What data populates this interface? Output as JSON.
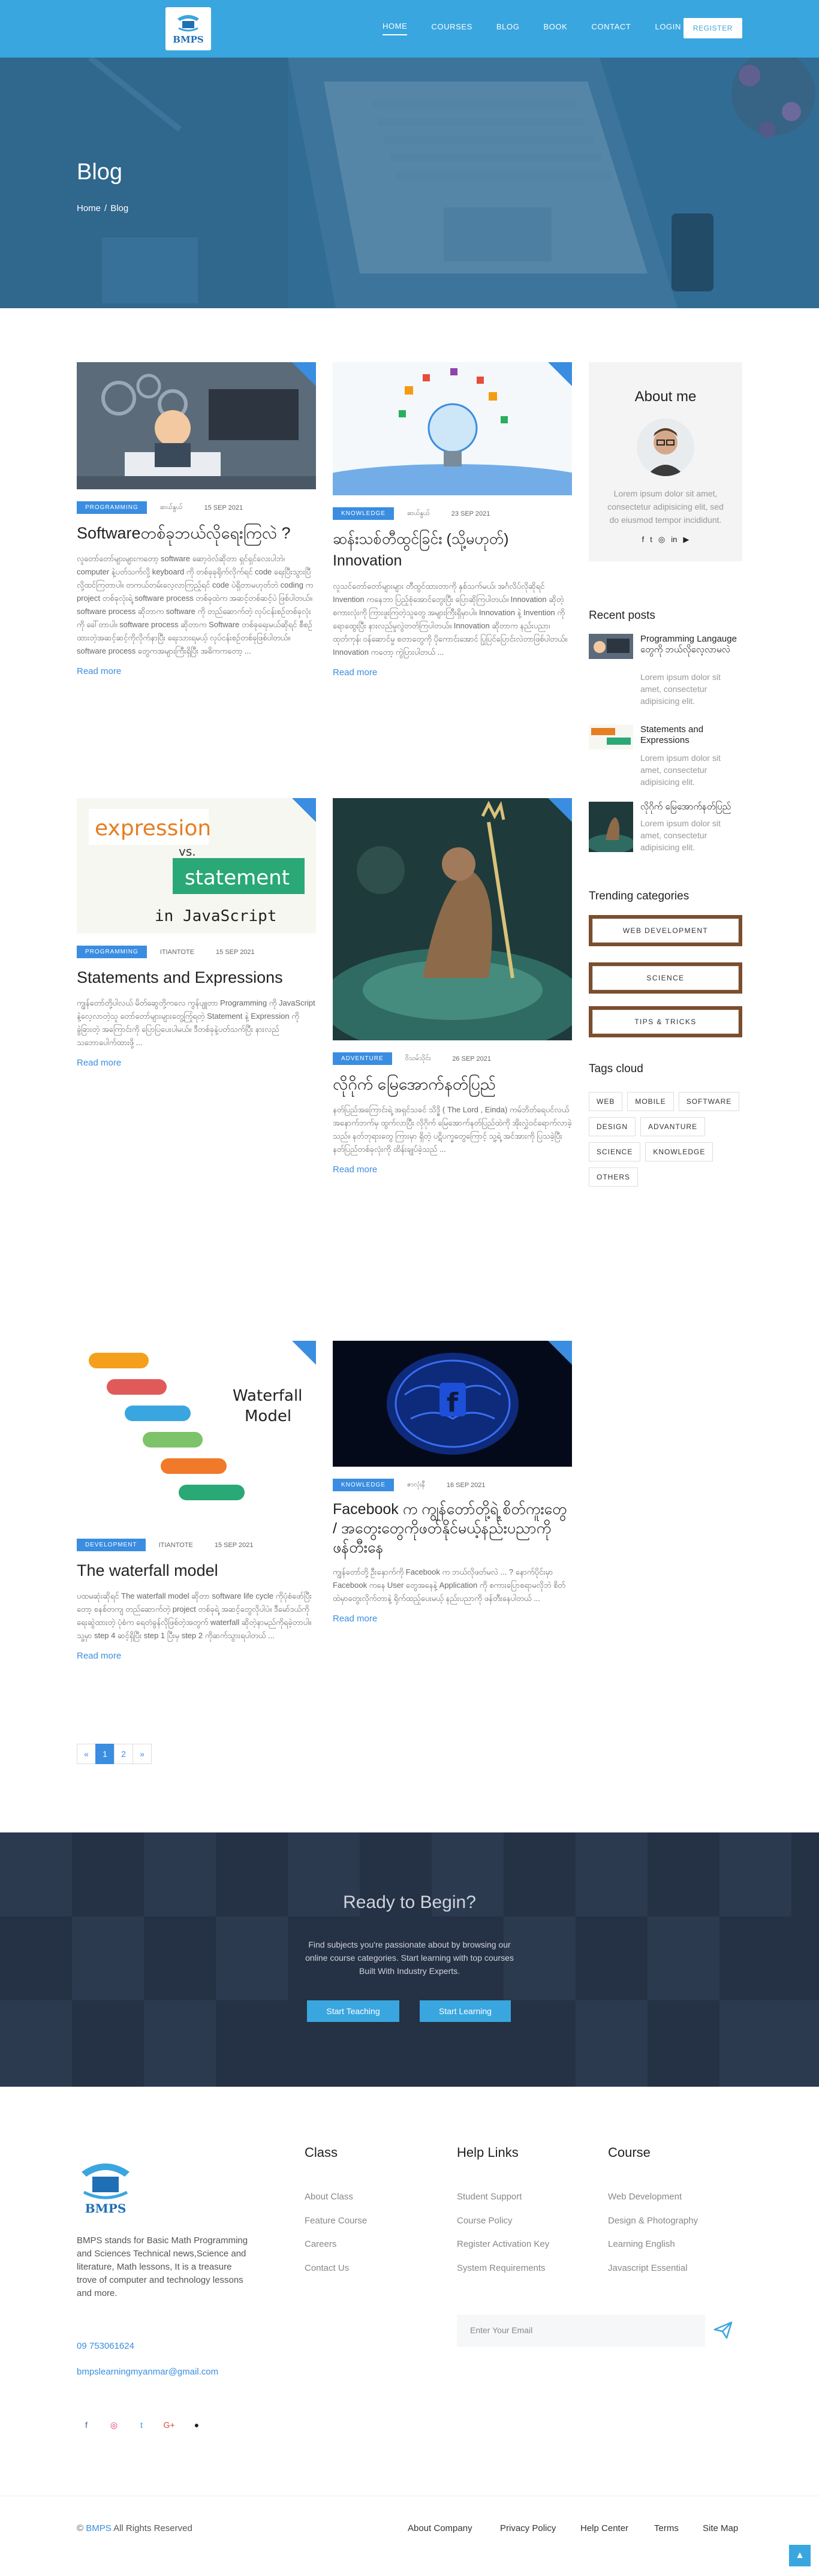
{
  "header": {
    "logo_text": "BMPS",
    "nav": [
      "HOME",
      "COURSES",
      "BLOG",
      "BOOK",
      "CONTACT",
      "LOGIN"
    ],
    "register": "REGISTER"
  },
  "hero": {
    "title": "Blog",
    "breadcrumb": [
      "Home",
      "/",
      "Blog"
    ]
  },
  "posts": [
    {
      "category": "PROGRAMMING",
      "author": "ဆယ်နွယ်",
      "date": "15 SEP 2021",
      "title": "Softwareတစ်ခုဘယ်လိုရေးကြလဲ ?",
      "excerpt": "လူတော်တော်များများကတော့ software ဆော့ဝဲလ်ဆိုတာ ရှင်ရှင်လေးပါဘဲ၊ computer နဲ့ပတ်သက်လို့ keyboard ကို တစ်ခုခုရိုက်လိုက်ရင် code ရေးပြီးသွားပြီလို့ထင်ကြတာပါ။ တကယ်တမ်းလေ့လာကြည့်ရင် code ပဲရှိတာမဟုတ်ဘဲ coding က project တစ်ခုလုံးရဲ့ software process တစ်ခုထဲက အဆင့်တစ်ဆင့်ပဲ ဖြစ်ပါတယ်။ software process ဆိုတာက software ကို တည်ဆောက်တဲ့ လုပ်ငန်းစဉ်တစ်ခုလုံးကို ခေါ်တာပါ။ software process ဆိုတာက Software တစ်ခုရေးမယ်ဆိုရင် စီစဉ်ထားတဲ့အဆင့်ဆင့်ကိုလိုက်နာပြီး ရေးသားရမယ့် လုပ်ငန်းစဉ်တစ်ခုဖြစ်ပါတယ်။ software process တွေကအများကြီးရှိပြီး အဓိကကတော့ ...",
      "more": "Read more"
    },
    {
      "category": "KNOWLEDGE",
      "author": "ဆယ်နွယ်",
      "date": "23 SEP 2021",
      "title": "ဆန်းသစ်တီထွင်ခြင်း (သို့မဟုတ်) Innovation",
      "excerpt": "လူသင်တော်တော်များများ တီထွင်ထားတာကို နှစ်သက်မယ်၊ အင်္ဂလိပ်လိုဆိုရင် Invention ကနေဘာ ပြည့်စုံအောင်တွေးပြီး ပြောဆိုကြပါတယ်။ Innovation ဆိုတဲ့ စကားလုံးကို ကြားဖူးကြတဲ့သူတွေ အများကြီးရှိမှာပါ။ Innovation နဲ့ Invention ကို ရောထွေးပြီး နားလည်မှုလွဲတတ်ကြပါတယ်။ Innovation ဆိုတာက နည်းပညာ၊ ထုတ်ကုန်၊ ဝန်ဆောင်မှု စတာတွေကို ပိုကောင်းအောင် ပြုပြင်ပြောင်းလဲတာဖြစ်ပါတယ်။ Innovation ကတော့ ကွဲပြားပါတယ် ...",
      "more": "Read more"
    },
    {
      "category": "PROGRAMMING",
      "author": "ITIANTOTE",
      "date": "15 SEP 2021",
      "title": "Statements and Expressions",
      "excerpt": "ကျွန်တော်တို့ပါလယ် မိတ်ဆွေတို့ကလေ ကွန်ပျူတာ Programming ကို JavaScript နဲ့လေ့လာတဲ့သူ တော်တော်များများတွေ့ကြုံရတဲ့ Statement နဲ့ Expression ကို ခွဲခြားတဲ့ အကြောင်းကို ပြောပြပေးပါမယ်။ ဒီတစ်ခုနဲ့ပတ်သက်ပြီး နားလည်သဘောပေါက်ထားဖို့ ...",
      "more": "Read more"
    },
    {
      "category": "ADVENTURE",
      "author": "ဝိသမ်သိုင်း",
      "date": "26 SEP 2021",
      "title": "လိုဂိုက် မြေအောက်နတ်ပြည်",
      "excerpt": "နတ်ပြည်အကြောင်းရဲ့ အရှင်သခင် သိဒ္ဓိ ( The Lord , Einda) ကမ်ဘိတ်ရေပင်လယ် အနောက်ဘက်မှ ထွက်လာပြီး လိုဂိုက် မြေအောက်နတ်ပြည်ထဲကို အိုးလွှဲဝင်ရောက်လာခဲ့သည်။ နတ်ဘုရားတွေ ကြားမှာ ရှိတဲ့ ပဋိပက္ခတွေကြောင့် သူ့ရဲ့ အင်အားကို ပြသခဲ့ပြီး နတ်ပြည်တစ်ခုလုံးကို ထိန်းချုပ်ခဲ့သည် ...",
      "more": "Read more"
    },
    {
      "category": "DEVELOPMENT",
      "author": "ITIANTOTE",
      "date": "15 SEP 2021",
      "title": "The waterfall model",
      "excerpt": "ပထမဆုံးဆိုရင် The waterfall model ဆိုတာ software life cycle ကိုပုံစံဖော်ပြီးတော့ စနစ်တကျ တည်ဆောက်တဲ့ project တစ်ခုရဲ့ အဆင့်တွေလိုပါပဲ။ ဒီမော်ဒယ်ကိုရေးဆွဲထားတဲ့ ပုံစံက ရေတံခွန်လိုဖြစ်တဲ့အတွက် waterfall ဆိုတဲ့နာမည်ကိုရခဲ့တာပါ။ သူ့မှာ step 4 ဆင့်ရှိပြီး step 1 ပြီးမှ step 2 ကိုဆက်သွားရပါတယ် ...",
      "more": "Read more"
    },
    {
      "category": "KNOWLEDGE",
      "author": "ဇာလုံးနီ",
      "date": "16 SEP 2021",
      "title": "Facebook က ကျွန်တော်တို့ရဲ့ စိတ်ကူးတွေ / အတွေးတွေကိုဖတ်နိုင်မယ့်နည်းပညာကို ဖန်တီးနေ",
      "excerpt": "ကျွန်တော်တို့ ဦးနှောက်ကို Facebook က ဘယ်လိုဖတ်မလဲ ... ? နောက်ပိုင်းမှာ Facebook ကနေ User တွေအနေနဲ့ Application ကို စကားပြောစရာမလိုဘဲ စိတ်ထဲမှာတွေးလိုက်တာနဲ့ ရိုက်ထည့်ပေးမယ့် နည်းပညာကို ဖန်တီးနေပါတယ် ...",
      "more": "Read more"
    }
  ],
  "sidebar": {
    "about_title": "About me",
    "about_text": "Lorem ipsum dolor sit amet, consectetur adipisicing elit, sed do eiusmod tempor incididunt.",
    "recent_title": "Recent posts",
    "recent": [
      {
        "title": "Programming Langauge တွေကို ဘယ်လိုလေ့လာမလဲ",
        "text": "Lorem ipsum dolor sit amet, consectetur adipisicing elit."
      },
      {
        "title": "Statements and Expressions",
        "text": "Lorem ipsum dolor sit amet, consectetur adipisicing elit."
      },
      {
        "title": "လိုဂိုက် မြေအောက်နတ်ပြည်",
        "text": "Lorem ipsum dolor sit amet, consectetur adipisicing elit."
      }
    ],
    "trending_title": "Trending categories",
    "trending": [
      "WEB DEVELOPMENT",
      "SCIENCE",
      "TIPS & TRICKS"
    ],
    "tags_title": "Tags cloud",
    "tags": [
      "WEB",
      "MOBILE",
      "SOFTWARE",
      "DESIGN",
      "ADVANTURE",
      "SCIENCE",
      "KNOWLEDGE",
      "OTHERS"
    ]
  },
  "pagination": [
    "«",
    "1",
    "2",
    "»"
  ],
  "cta": {
    "title": "Ready to Begin?",
    "text": "Find subjects you're passionate about by browsing our online course categories. Start learning with top courses Built With Industry Experts.",
    "btn_teach": "Start Teaching",
    "btn_learn": "Start Learning"
  },
  "footer": {
    "desc": "BMPS stands for Basic Math Programming and Sciences Technical news,Science and literature, Math lessons, It is a treasure trove of computer and technology lessons and more.",
    "phone": "09 753061624",
    "email": "bmpslearningmyanmar@gmail.com",
    "class_title": "Class",
    "class_links": [
      "About Class",
      "Feature Course",
      "Careers",
      "Contact Us"
    ],
    "help_title": "Help Links",
    "help_links": [
      "Student Support",
      "Course Policy",
      "Register Activation Key",
      "System Requirements"
    ],
    "course_title": "Course",
    "course_links": [
      "Web Development",
      "Design & Photography",
      "Learning English",
      "Javascript Essential"
    ],
    "subscribe_placeholder": "Enter Your Email",
    "copy_prefix": "©",
    "copy_brand": "BMPS",
    "copy_suffix": "All Rights Reserved",
    "bottom_links": [
      "About Company",
      "Privacy Policy",
      "Help Center",
      "Terms",
      "Site Map"
    ]
  },
  "icons": [
    "facebook-icon",
    "twitter-icon",
    "instagram-icon",
    "youtube-icon",
    "github-icon",
    "google-plus-icon",
    "send-icon",
    "arrow-up-icon"
  ],
  "colors": {
    "primary": "#3aa6df",
    "accent": "#3a8de0",
    "cta_bg": "#253144"
  }
}
